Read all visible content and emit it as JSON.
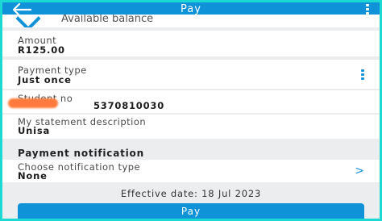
{
  "header": {
    "back_icon": "arrow-left-icon",
    "title": "Pay",
    "menu_icon": "kebab-menu-icon"
  },
  "balance": {
    "label": "Available balance"
  },
  "fields": {
    "amount": {
      "label": "Amount",
      "value": "R125.00"
    },
    "payment_type": {
      "label": "Payment type",
      "value": "Just once"
    },
    "student_no": {
      "label": "Student no",
      "value": "5370810030"
    },
    "statement_description": {
      "label": "My statement description",
      "value": "Unisa"
    }
  },
  "notification": {
    "section_title": "Payment notification",
    "label": "Choose notification type",
    "value": "None"
  },
  "effective_date": "Effective date: 18 Jul 2023",
  "pay_button": "Pay",
  "colors": {
    "accent": "#0f92d8",
    "border": "#1cd9d4"
  }
}
